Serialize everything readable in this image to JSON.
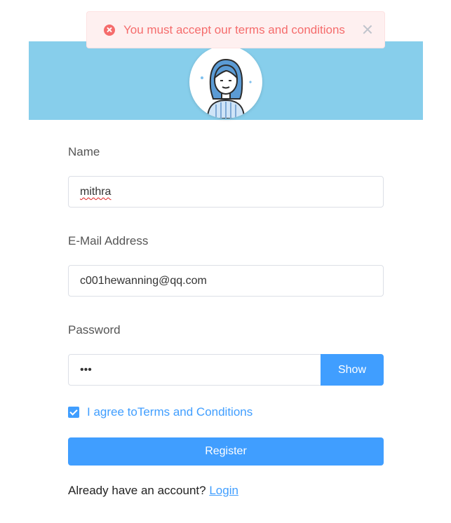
{
  "toast": {
    "message": "You must accept our terms and conditions",
    "icon": "error-circle-icon",
    "close_icon": "close-icon"
  },
  "form": {
    "name_label": "Name",
    "name_value": "mithra",
    "email_label": "E-Mail Address",
    "email_value": "c001hewanning@qq.com",
    "password_label": "Password",
    "password_value": "•••",
    "show_label": "Show",
    "agree_prefix": "I agree to",
    "agree_link": "Terms and Conditions",
    "agree_checked": true,
    "register_label": "Register",
    "login_prompt": "Already have an account?",
    "login_link": "Login"
  },
  "colors": {
    "header_band": "#87ceeb",
    "accent": "#409eff",
    "error": "#f56c6c",
    "error_bg": "#fef0f0"
  }
}
